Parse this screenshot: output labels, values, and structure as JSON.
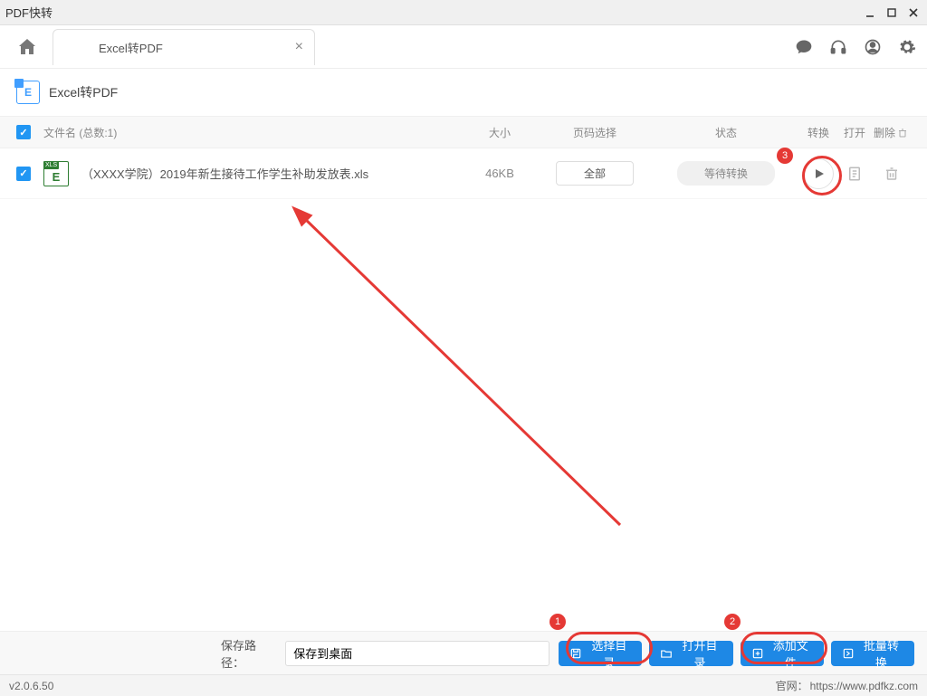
{
  "window": {
    "title": "PDF快转"
  },
  "tab": {
    "label": "Excel转PDF"
  },
  "subheader": {
    "title": "Excel转PDF"
  },
  "table": {
    "headers": {
      "filename": "文件名 (总数:1)",
      "size": "大小",
      "pages": "页码选择",
      "status": "状态",
      "convert": "转换",
      "open": "打开",
      "delete": "删除"
    },
    "rows": [
      {
        "filename": "（XXXX学院）2019年新生接待工作学生补助发放表.xls",
        "size": "46KB",
        "pages_label": "全部",
        "status": "等待转换"
      }
    ]
  },
  "bottom": {
    "save_label": "保存路径：",
    "save_value": "保存到桌面",
    "btn_select_dir": "选择目录",
    "btn_open_dir": "打开目录",
    "btn_add_file": "添加文件",
    "btn_batch": "批量转换"
  },
  "statusbar": {
    "version": "v2.0.6.50",
    "website_label": "官网：",
    "website_url": "https://www.pdfkz.com"
  },
  "annotations": {
    "b1": "1",
    "b2": "2",
    "b3": "3"
  }
}
